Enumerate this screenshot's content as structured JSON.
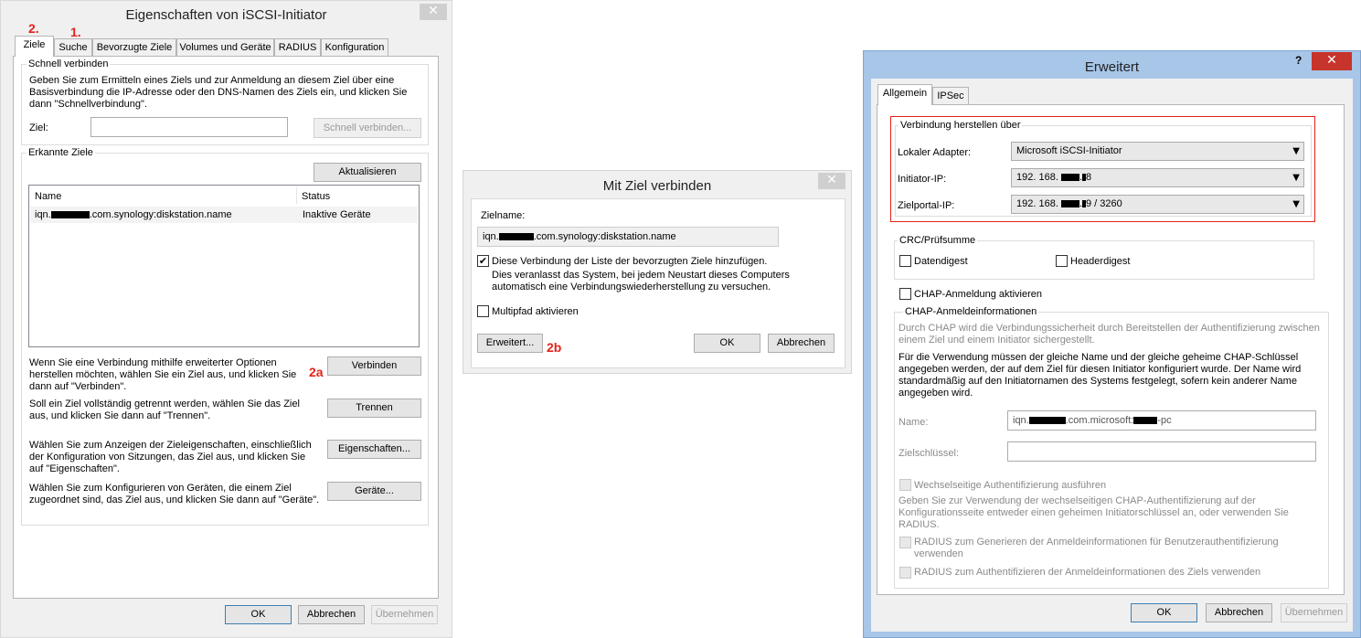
{
  "window1": {
    "title": "Eigenschaften von iSCSI-Initiator",
    "close": "✕",
    "tabs": [
      "Ziele",
      "Suche",
      "Bevorzugte Ziele",
      "Volumes und Geräte",
      "RADIUS",
      "Konfiguration"
    ],
    "annot_tab_ziele": "2.",
    "annot_tab_suche": "1.",
    "quick": {
      "title": "Schnell verbinden",
      "desc_line1": "Geben Sie zum Ermitteln eines Ziels und zur Anmeldung an diesem Ziel über eine",
      "desc_line2": "Basisverbindung die IP-Adresse oder den DNS-Namen des Ziels ein, und klicken Sie",
      "desc_line3": "dann \"Schnellverbindung\".",
      "target_label": "Ziel:",
      "target_value": "",
      "connect_button": "Schnell verbinden..."
    },
    "discovered": {
      "title": "Erkannte Ziele",
      "refresh_button": "Aktualisieren",
      "columns": [
        "Name",
        "Status"
      ],
      "rows": [
        {
          "name_prefix": "iqn.",
          "name_suffix": ".com.synology:diskstation.name",
          "status": "Inaktive Geräte"
        }
      ]
    },
    "connect_desc_line1": "Wenn Sie eine Verbindung mithilfe erweiterter Optionen",
    "connect_desc_line2": "herstellen möchten, wählen Sie ein Ziel aus, und klicken Sie",
    "connect_desc_line3": "dann auf \"Verbinden\".",
    "connect_button": "Verbinden",
    "annot_connect": "2a",
    "disconnect_desc_line1": "Soll ein Ziel vollständig getrennt werden, wählen Sie das Ziel",
    "disconnect_desc_line2": "aus, und klicken Sie dann auf \"Trennen\".",
    "disconnect_button": "Trennen",
    "props_desc_line1": "Wählen Sie zum Anzeigen der Zieleigenschaften, einschließlich",
    "props_desc_line2": "der Konfiguration von Sitzungen, das Ziel aus, und klicken Sie",
    "props_desc_line3": "auf \"Eigenschaften\".",
    "props_button": "Eigenschaften...",
    "devices_desc_line1": "Wählen Sie zum Konfigurieren von Geräten, die einem Ziel",
    "devices_desc_line2": "zugeordnet sind, das Ziel aus, und klicken Sie dann auf \"Geräte\".",
    "devices_button": "Geräte...",
    "ok": "OK",
    "cancel": "Abbrechen",
    "apply": "Übernehmen"
  },
  "window2": {
    "title": "Mit Ziel verbinden",
    "close": "✕",
    "target_name_label": "Zielname:",
    "target_prefix": "iqn.",
    "target_suffix": ".com.synology:diskstation.name",
    "favorites_checked": true,
    "favorites_line1": "Diese Verbindung der Liste der bevorzugten Ziele hinzufügen.",
    "favorites_line2": "Dies veranlasst das System, bei jedem Neustart dieses Computers",
    "favorites_line3": "automatisch eine Verbindungswiederherstellung zu versuchen.",
    "multipath_checked": false,
    "multipath_label": "Multipfad aktivieren",
    "advanced_button": "Erweitert...",
    "annot_advanced": "2b",
    "ok": "OK",
    "cancel": "Abbrechen"
  },
  "window3": {
    "title": "Erweitert",
    "help": "?",
    "close": "✕",
    "tabs": [
      "Allgemein",
      "IPSec"
    ],
    "connect_via": {
      "title": "Verbindung herstellen über",
      "adapter_label": "Lokaler Adapter:",
      "adapter_value": "Microsoft iSCSI-Initiator",
      "initiator_label": "Initiator-IP:",
      "initiator_prefix": "192. 168.",
      "initiator_suffix": "8",
      "portal_label": "Zielportal-IP:",
      "portal_prefix": "192. 168.",
      "portal_suffix": "9 / 3260"
    },
    "crc": {
      "title": "CRC/Prüfsumme",
      "data_digest": "Datendigest",
      "header_digest": "Headerdigest"
    },
    "chap_enable": "CHAP-Anmeldung aktivieren",
    "chap_info": {
      "title": "CHAP-Anmeldeinformationen",
      "desc1_line1": "Durch CHAP wird die Verbindungssicherheit durch Bereitstellen der Authentifizierung zwischen",
      "desc1_line2": "einem Ziel und einem Initiator sichergestellt.",
      "desc2_line1": "Für die Verwendung müssen der gleiche Name und der gleiche geheime CHAP-Schlüssel",
      "desc2_line2": "angegeben werden, der auf dem Ziel für diesen Initiator konfiguriert wurde. Der Name wird",
      "desc2_line3": "standardmäßig auf den Initiatornamen des Systems festgelegt, sofern kein anderer Name",
      "desc2_line4": "angegeben wird.",
      "name_label": "Name:",
      "name_prefix": "iqn.",
      "name_middle": ".com.microsoft:",
      "name_suffix": "-pc",
      "secret_label": "Zielschlüssel:",
      "secret_value": "",
      "mutual_label": "Wechselseitige Authentifizierung ausführen",
      "mutual_desc_line1": "Geben Sie zur Verwendung der wechselseitigen CHAP-Authentifizierung auf der",
      "mutual_desc_line2": "Konfigurationsseite entweder einen geheimen Initiatorschlüssel an, oder verwenden Sie",
      "mutual_desc_line3": "RADIUS.",
      "radius1_line1": "RADIUS zum Generieren der Anmeldeinformationen für Benutzerauthentifizierung",
      "radius1_line2": "verwenden",
      "radius2": "RADIUS zum Authentifizieren der Anmeldeinformationen des Ziels verwenden"
    },
    "ok": "OK",
    "cancel": "Abbrechen",
    "apply": "Übernehmen"
  },
  "colors": {
    "annotation_red": "#e2231a",
    "close_red": "#c7342b",
    "win8_frame": "#a7c6e8"
  }
}
